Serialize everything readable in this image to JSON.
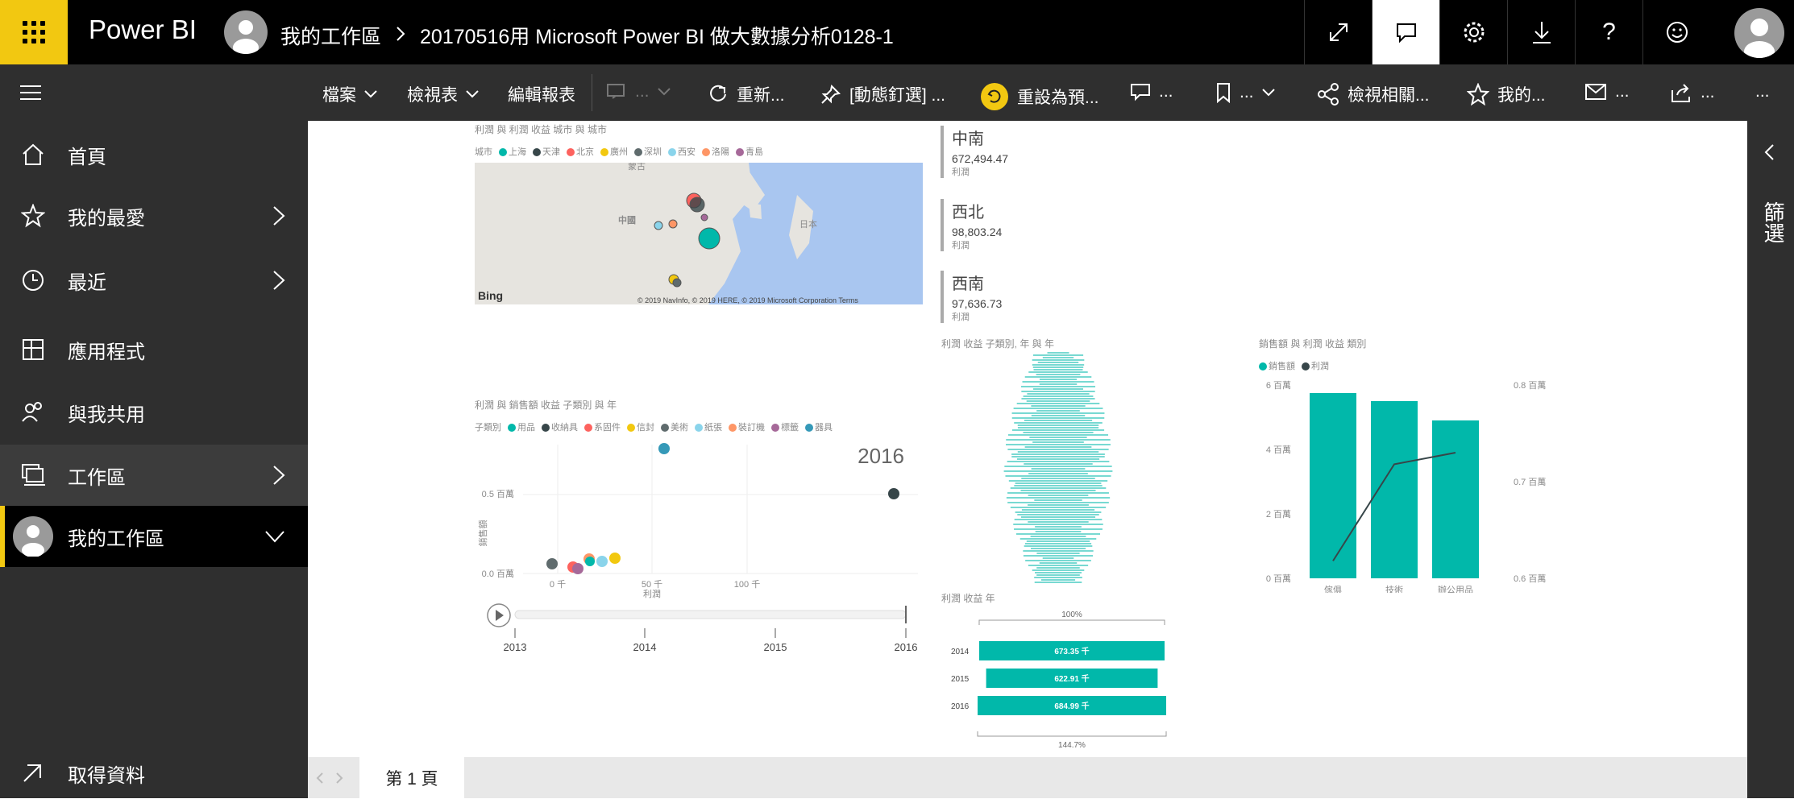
{
  "app": {
    "brand": "Power BI",
    "breadcrumb_workspace": "我的工作區",
    "breadcrumb_report": "20170516用 Microsoft Power BI 做大數據分析0128-1"
  },
  "topbar": {
    "icons": [
      "expand-icon",
      "comment-icon",
      "gear-icon",
      "download-icon",
      "help-icon",
      "smiley-icon",
      "user-avatar"
    ]
  },
  "toolbar": {
    "file": "檔案",
    "view": "檢視表",
    "edit": "編輯報表",
    "disabled_more": "...",
    "refresh": "重新...",
    "pin": "[動態釘選] ...",
    "reset": "重設為預...",
    "comment_more": "...",
    "bookmark_more": "...",
    "related": "檢視相關...",
    "favorite": "我的...",
    "subscribe_more": "...",
    "share_more": "...",
    "overflow": "..."
  },
  "sidebar": {
    "items": [
      {
        "label": "首頁",
        "icon": "home-icon"
      },
      {
        "label": "我的最愛",
        "icon": "star-icon"
      },
      {
        "label": "最近",
        "icon": "clock-icon"
      },
      {
        "label": "應用程式",
        "icon": "apps-icon"
      },
      {
        "label": "與我共用",
        "icon": "shared-icon"
      },
      {
        "label": "工作區",
        "icon": "workspaces-icon"
      },
      {
        "label": "我的工作區",
        "icon": "avatar"
      }
    ],
    "get_data": "取得資料"
  },
  "rightpane": {
    "filters": "篩選"
  },
  "pages": {
    "tab1": "第 1 頁"
  },
  "colors": {
    "accent": "#F2C811",
    "teal": "#01B8AA",
    "dark": "#374649",
    "red": "#FD625E",
    "yellow": "#F2C80F",
    "gray": "#5F6B6D",
    "lightblue": "#8AD4EB",
    "orange": "#FE9666",
    "purple": "#A66999",
    "blue": "#3599B8"
  },
  "map": {
    "title": "利潤 與 利潤 收益 城市 與 城市",
    "legend_title": "城市",
    "legend": [
      "上海",
      "天津",
      "北京",
      "廣州",
      "深圳",
      "西安",
      "洛陽",
      "青島"
    ],
    "labels": {
      "mongolia": "蒙古",
      "china": "中國",
      "japan": "日本",
      "bing": "Bing",
      "copyright": "© 2019 NavInfo, © 2019 HERE, © 2019 Microsoft Corporation  Terms"
    }
  },
  "cards": [
    {
      "name": "中南",
      "value": "672,494.47",
      "sub": "利潤"
    },
    {
      "name": "西北",
      "value": "98,803.24",
      "sub": "利潤"
    },
    {
      "name": "西南",
      "value": "97,636.73",
      "sub": "利潤"
    }
  ],
  "scatter": {
    "title": "利潤 與 銷售額 收益 子類別 與 年",
    "legend_title": "子類別",
    "legend": [
      "用品",
      "收納具",
      "系固件",
      "信封",
      "美術",
      "紙張",
      "裝訂機",
      "標籤",
      "器具"
    ],
    "year": "2016",
    "ytick_top": "0.5 百萬",
    "ytick_bottom": "0.0 百萬",
    "ylabel": "銷售額",
    "xticks": [
      "0 千",
      "50 千",
      "100 千"
    ],
    "xlabel": "利潤",
    "play": [
      "2013",
      "2014",
      "2015",
      "2016"
    ]
  },
  "tornado": {
    "title": "利潤 收益 子類別, 年 與 年"
  },
  "combo": {
    "title": "銷售額 與 利潤 收益 類別",
    "legend": [
      "銷售額",
      "利潤"
    ],
    "yleft": [
      "6 百萬",
      "4 百萬",
      "2 百萬",
      "0 百萬"
    ],
    "yright": [
      "0.8 百萬",
      "0.7 百萬",
      "0.6 百萬"
    ],
    "categories": [
      "傢俱",
      "技術",
      "辦公用品"
    ]
  },
  "funnel": {
    "title": "利潤 收益 年",
    "top_pct": "100%",
    "bottom_pct": "144.7%",
    "rows": [
      {
        "label": "2014",
        "value": "673.35 千"
      },
      {
        "label": "2015",
        "value": "622.91 千"
      },
      {
        "label": "2016",
        "value": "684.99 千"
      }
    ]
  },
  "chart_data": [
    {
      "type": "bar",
      "title": "銷售額 與 利潤 收益 類別",
      "categories": [
        "傢俱",
        "技術",
        "辦公用品"
      ],
      "series": [
        {
          "name": "銷售額",
          "values": [
            5.75,
            5.5,
            4.9
          ]
        },
        {
          "name": "利潤",
          "values": [
            0.618,
            0.718,
            0.73
          ]
        }
      ],
      "ylim": [
        0,
        6
      ],
      "y2lim": [
        0.6,
        0.8
      ]
    },
    {
      "type": "bar",
      "title": "利潤 收益 年",
      "categories": [
        "2014",
        "2015",
        "2016"
      ],
      "values": [
        673.35,
        622.91,
        684.99
      ]
    }
  ]
}
